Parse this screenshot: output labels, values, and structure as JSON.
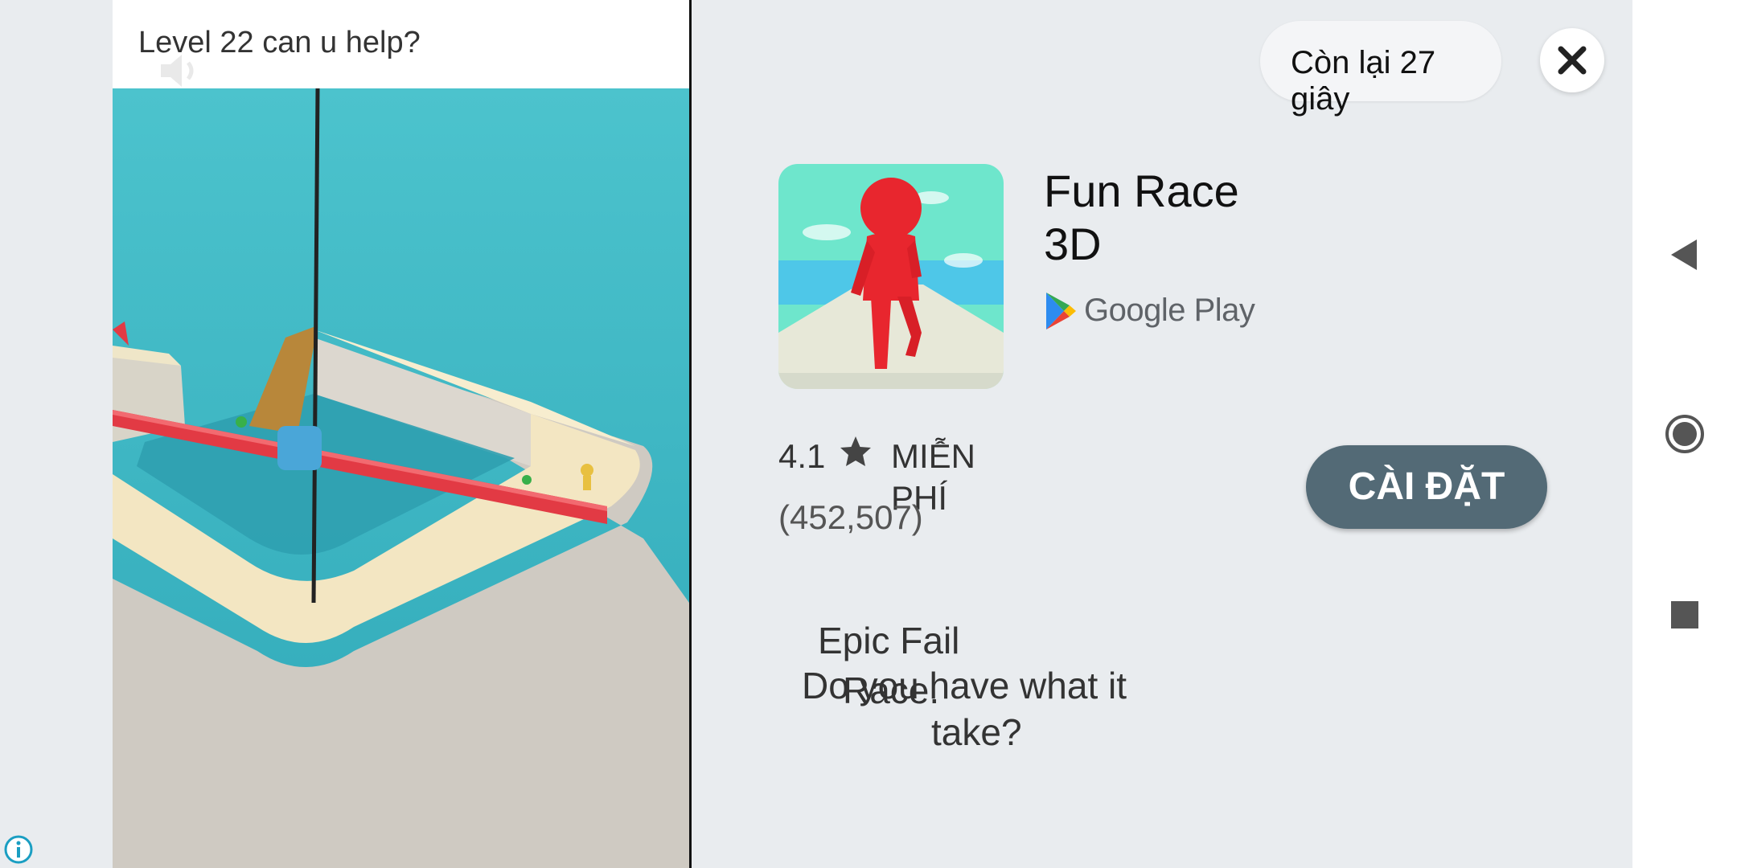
{
  "video": {
    "caption": "Level 22 can u help?"
  },
  "ad": {
    "countdown": "Còn lại 27 giây",
    "app_title": "Fun Race 3D",
    "store_name": "Google Play",
    "rating": "4.1",
    "price_label": "MIỄN PHÍ",
    "review_count": "(452,507)",
    "install_label": "CÀI ĐẶT",
    "description_line1": "Epic Fail",
    "description_line2": "Do you have what it",
    "description_line3": "Race.",
    "description_line4": "take?"
  },
  "colors": {
    "install_button": "#536a76",
    "panel_bg": "#e9ecef",
    "water": "#3fb8c4"
  },
  "icons": [
    "speaker-icon",
    "close-icon",
    "google-play-icon",
    "star-icon",
    "back-icon",
    "home-icon",
    "recents-icon",
    "info-icon"
  ]
}
